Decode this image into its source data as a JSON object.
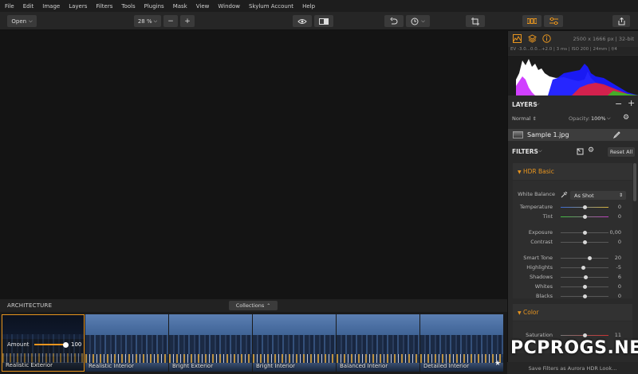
{
  "menu": [
    "File",
    "Edit",
    "Image",
    "Layers",
    "Filters",
    "Tools",
    "Plugins",
    "Mask",
    "View",
    "Window",
    "Skylum Account",
    "Help"
  ],
  "toolbar": {
    "open_label": "Open",
    "zoom": "28 %",
    "minus": "−",
    "plus": "+"
  },
  "presets": {
    "category": "ARCHITECTURE",
    "collections_label": "Collections",
    "items": [
      "Realistic Exterior",
      "Realistic Interior",
      "Bright Exterior",
      "Bright Interior",
      "Balanced Interior",
      "Detailed Interior"
    ],
    "amount_label": "Amount",
    "amount_value": "100"
  },
  "info": {
    "dimensions": "2500 x 1666 px  |  32-bit",
    "exif": "EV -3.0...0.0...+2.0  |  3 ms  |  ISO 200  |  24mm  |  f/4"
  },
  "layers": {
    "title": "LAYERS",
    "blend_mode": "Normal",
    "opacity_label": "Opacity:",
    "opacity_value": "100%",
    "layer_name": "Sample 1.jpg"
  },
  "filters": {
    "title": "FILTERS",
    "reset_label": "Reset All",
    "hdr_title": "HDR Basic",
    "white_balance_label": "White Balance",
    "white_balance_value": "As Shot",
    "params": [
      {
        "label": "Temperature",
        "value": "0",
        "pos": 0.5
      },
      {
        "label": "Tint",
        "value": "0",
        "pos": 0.5
      },
      {
        "label": "Exposure",
        "value": "0,00",
        "pos": 0.5
      },
      {
        "label": "Contrast",
        "value": "0",
        "pos": 0.5
      },
      {
        "label": "Smart Tone",
        "value": "20",
        "pos": 0.6
      },
      {
        "label": "Highlights",
        "value": "-5",
        "pos": 0.47
      },
      {
        "label": "Shadows",
        "value": "6",
        "pos": 0.53
      },
      {
        "label": "Whites",
        "value": "0",
        "pos": 0.5
      },
      {
        "label": "Blacks",
        "value": "0",
        "pos": 0.5
      }
    ],
    "color_title": "Color",
    "saturation_label": "Saturation",
    "saturation_value": "11"
  },
  "status": {
    "save_filters_label": "Save Filters as Aurora HDR Look..."
  },
  "watermark": "PCPROGS.NET",
  "colors": {
    "accent": "#e8951f",
    "panel": "#2a2a2a",
    "canvas": "#141414"
  }
}
